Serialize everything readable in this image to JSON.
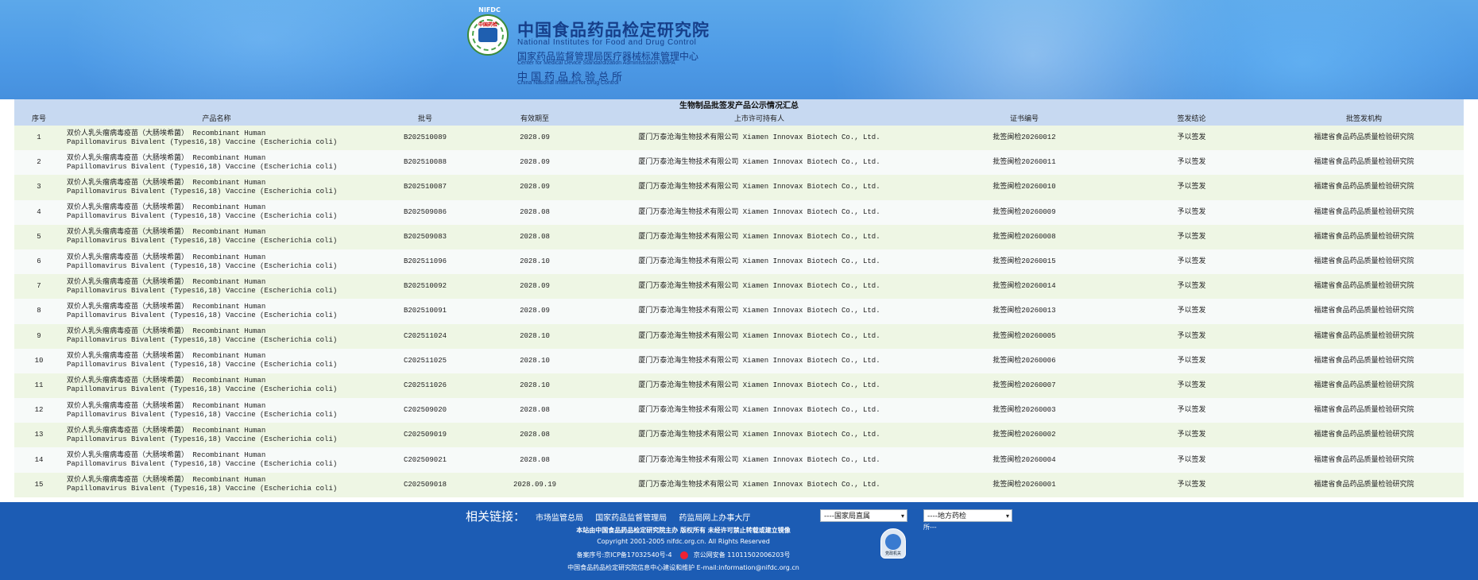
{
  "header": {
    "emblem_top": "NIFDC",
    "emblem_seal": "中国药检",
    "org_title": "中国食品药品检定研究院",
    "org_en": "National Institutes for Food and Drug Control",
    "org_sub": "国家药品监督管理局医疗器械标准管理中心",
    "org_sub_en": "Center for Medical Device Standardization Administration NMPA",
    "org_old": "中国药品检验总所",
    "org_old_en": "China National Institutes for Drug Control"
  },
  "table": {
    "title": "生物制品批签发产品公示情况汇总",
    "columns": [
      "序号",
      "产品名称",
      "批号",
      "有效期至",
      "上市许可持有人",
      "证书编号",
      "签发结论",
      "批签发机构"
    ],
    "rows": [
      {
        "no": "1",
        "name1": "双价人乳头瘤病毒疫苗（大肠埃希菌） Recombinant Human",
        "name2": "Papillomavirus Bivalent (Types16,18) Vaccine (Escherichia coli)",
        "lot": "B202510089",
        "expiry": "2028.09",
        "holder": "厦门万泰沧海生物技术有限公司 Xiamen Innovax Biotech Co., Ltd.",
        "cert": "批签闽检20260012",
        "result": "予以签发",
        "agency": "福建省食品药品质量检验研究院"
      },
      {
        "no": "2",
        "name1": "双价人乳头瘤病毒疫苗（大肠埃希菌） Recombinant Human",
        "name2": "Papillomavirus Bivalent (Types16,18) Vaccine (Escherichia coli)",
        "lot": "B202510088",
        "expiry": "2028.09",
        "holder": "厦门万泰沧海生物技术有限公司 Xiamen Innovax Biotech Co., Ltd.",
        "cert": "批签闽检20260011",
        "result": "予以签发",
        "agency": "福建省食品药品质量检验研究院"
      },
      {
        "no": "3",
        "name1": "双价人乳头瘤病毒疫苗（大肠埃希菌） Recombinant Human",
        "name2": "Papillomavirus Bivalent (Types16,18) Vaccine (Escherichia coli)",
        "lot": "B202510087",
        "expiry": "2028.09",
        "holder": "厦门万泰沧海生物技术有限公司 Xiamen Innovax Biotech Co., Ltd.",
        "cert": "批签闽检20260010",
        "result": "予以签发",
        "agency": "福建省食品药品质量检验研究院"
      },
      {
        "no": "4",
        "name1": "双价人乳头瘤病毒疫苗（大肠埃希菌） Recombinant Human",
        "name2": "Papillomavirus Bivalent (Types16,18) Vaccine (Escherichia coli)",
        "lot": "B202509086",
        "expiry": "2028.08",
        "holder": "厦门万泰沧海生物技术有限公司 Xiamen Innovax Biotech Co., Ltd.",
        "cert": "批签闽检20260009",
        "result": "予以签发",
        "agency": "福建省食品药品质量检验研究院"
      },
      {
        "no": "5",
        "name1": "双价人乳头瘤病毒疫苗（大肠埃希菌） Recombinant Human",
        "name2": "Papillomavirus Bivalent (Types16,18) Vaccine (Escherichia coli)",
        "lot": "B202509083",
        "expiry": "2028.08",
        "holder": "厦门万泰沧海生物技术有限公司 Xiamen Innovax Biotech Co., Ltd.",
        "cert": "批签闽检20260008",
        "result": "予以签发",
        "agency": "福建省食品药品质量检验研究院"
      },
      {
        "no": "6",
        "name1": "双价人乳头瘤病毒疫苗（大肠埃希菌） Recombinant Human",
        "name2": "Papillomavirus Bivalent (Types16,18) Vaccine (Escherichia coli)",
        "lot": "B202511096",
        "expiry": "2028.10",
        "holder": "厦门万泰沧海生物技术有限公司 Xiamen Innovax Biotech Co., Ltd.",
        "cert": "批签闽检20260015",
        "result": "予以签发",
        "agency": "福建省食品药品质量检验研究院"
      },
      {
        "no": "7",
        "name1": "双价人乳头瘤病毒疫苗（大肠埃希菌） Recombinant Human",
        "name2": "Papillomavirus Bivalent (Types16,18) Vaccine (Escherichia coli)",
        "lot": "B202510092",
        "expiry": "2028.09",
        "holder": "厦门万泰沧海生物技术有限公司 Xiamen Innovax Biotech Co., Ltd.",
        "cert": "批签闽检20260014",
        "result": "予以签发",
        "agency": "福建省食品药品质量检验研究院"
      },
      {
        "no": "8",
        "name1": "双价人乳头瘤病毒疫苗（大肠埃希菌） Recombinant Human",
        "name2": "Papillomavirus Bivalent (Types16,18) Vaccine (Escherichia coli)",
        "lot": "B202510091",
        "expiry": "2028.09",
        "holder": "厦门万泰沧海生物技术有限公司 Xiamen Innovax Biotech Co., Ltd.",
        "cert": "批签闽检20260013",
        "result": "予以签发",
        "agency": "福建省食品药品质量检验研究院"
      },
      {
        "no": "9",
        "name1": "双价人乳头瘤病毒疫苗（大肠埃希菌） Recombinant Human",
        "name2": "Papillomavirus Bivalent (Types16,18) Vaccine (Escherichia coli)",
        "lot": "C202511024",
        "expiry": "2028.10",
        "holder": "厦门万泰沧海生物技术有限公司 Xiamen Innovax Biotech Co., Ltd.",
        "cert": "批签闽检20260005",
        "result": "予以签发",
        "agency": "福建省食品药品质量检验研究院"
      },
      {
        "no": "10",
        "name1": "双价人乳头瘤病毒疫苗（大肠埃希菌） Recombinant Human",
        "name2": "Papillomavirus Bivalent (Types16,18) Vaccine (Escherichia coli)",
        "lot": "C202511025",
        "expiry": "2028.10",
        "holder": "厦门万泰沧海生物技术有限公司 Xiamen Innovax Biotech Co., Ltd.",
        "cert": "批签闽检20260006",
        "result": "予以签发",
        "agency": "福建省食品药品质量检验研究院"
      },
      {
        "no": "11",
        "name1": "双价人乳头瘤病毒疫苗（大肠埃希菌） Recombinant Human",
        "name2": "Papillomavirus Bivalent (Types16,18) Vaccine (Escherichia coli)",
        "lot": "C202511026",
        "expiry": "2028.10",
        "holder": "厦门万泰沧海生物技术有限公司 Xiamen Innovax Biotech Co., Ltd.",
        "cert": "批签闽检20260007",
        "result": "予以签发",
        "agency": "福建省食品药品质量检验研究院"
      },
      {
        "no": "12",
        "name1": "双价人乳头瘤病毒疫苗（大肠埃希菌） Recombinant Human",
        "name2": "Papillomavirus Bivalent (Types16,18) Vaccine (Escherichia coli)",
        "lot": "C202509020",
        "expiry": "2028.08",
        "holder": "厦门万泰沧海生物技术有限公司 Xiamen Innovax Biotech Co., Ltd.",
        "cert": "批签闽检20260003",
        "result": "予以签发",
        "agency": "福建省食品药品质量检验研究院"
      },
      {
        "no": "13",
        "name1": "双价人乳头瘤病毒疫苗（大肠埃希菌） Recombinant Human",
        "name2": "Papillomavirus Bivalent (Types16,18) Vaccine (Escherichia coli)",
        "lot": "C202509019",
        "expiry": "2028.08",
        "holder": "厦门万泰沧海生物技术有限公司 Xiamen Innovax Biotech Co., Ltd.",
        "cert": "批签闽检20260002",
        "result": "予以签发",
        "agency": "福建省食品药品质量检验研究院"
      },
      {
        "no": "14",
        "name1": "双价人乳头瘤病毒疫苗（大肠埃希菌） Recombinant Human",
        "name2": "Papillomavirus Bivalent (Types16,18) Vaccine (Escherichia coli)",
        "lot": "C202509021",
        "expiry": "2028.08",
        "holder": "厦门万泰沧海生物技术有限公司 Xiamen Innovax Biotech Co., Ltd.",
        "cert": "批签闽检20260004",
        "result": "予以签发",
        "agency": "福建省食品药品质量检验研究院"
      },
      {
        "no": "15",
        "name1": "双价人乳头瘤病毒疫苗（大肠埃希菌） Recombinant Human",
        "name2": "Papillomavirus Bivalent (Types16,18) Vaccine (Escherichia coli)",
        "lot": "C202509018",
        "expiry": "2028.09.19",
        "holder": "厦门万泰沧海生物技术有限公司 Xiamen Innovax Biotech Co., Ltd.",
        "cert": "批签闽检20260001",
        "result": "予以签发",
        "agency": "福建省食品药品质量检验研究院"
      }
    ]
  },
  "footer": {
    "related_label": "相关链接：",
    "links": [
      "市场监管总局",
      "国家药品监督管理局",
      "药监局网上办事大厅"
    ],
    "select_national": "----国家局直属",
    "select_local": "----地方药检",
    "select_note": "所---",
    "line1": "本站由中国食品药品检定研究院主办 版权所有 未经许可禁止转载或建立镜像",
    "line2": "Copyright 2001-2005 nifdc.org.cn. All Rights Reserved",
    "icp": "备案序号:京ICP备17032540号-4",
    "police": "京公网安备 11011502006203号",
    "line4": "中国食品药品检定研究院信息中心建设和维护 E-mail:information@nifdc.org.cn",
    "badge_text": "党政机关"
  },
  "colors": {
    "banner_blue": "#4d9ae6",
    "title_navy": "#163f8a",
    "table_header_bg": "#c7d9f1",
    "row_odd_bg": "#eef6e4",
    "row_even_bg": "#f7faf9",
    "footer_blue": "#1c5cb4"
  }
}
